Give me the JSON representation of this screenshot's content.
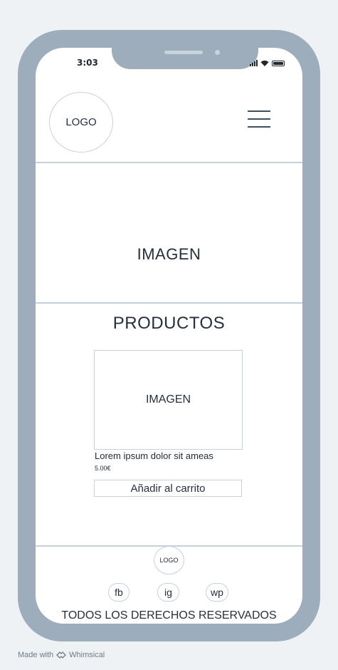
{
  "status_bar": {
    "time": "3:03"
  },
  "header": {
    "logo_text": "LOGO"
  },
  "hero": {
    "image_text": "IMAGEN"
  },
  "products": {
    "title": "PRODUCTOS",
    "items": [
      {
        "image_text": "IMAGEN",
        "name": "Lorem ipsum dolor sit ameas",
        "price": "5.00€",
        "button_label": "Añadir al carrito"
      }
    ]
  },
  "footer": {
    "logo_text": "LOGO",
    "social": [
      "fb",
      "ig",
      "wp"
    ],
    "rights": "TODOS LOS DERECHOS RESERVADOS"
  },
  "watermark": {
    "text": "Made with",
    "brand": "Whimsical"
  },
  "colors": {
    "frame": "#9dadbb",
    "border": "#c6d1da",
    "background": "#eef2f5",
    "text": "#24303d"
  },
  "icons": [
    "signal-icon",
    "wifi-icon",
    "battery-icon",
    "hamburger-menu-icon",
    "whimsical-logo-icon"
  ]
}
